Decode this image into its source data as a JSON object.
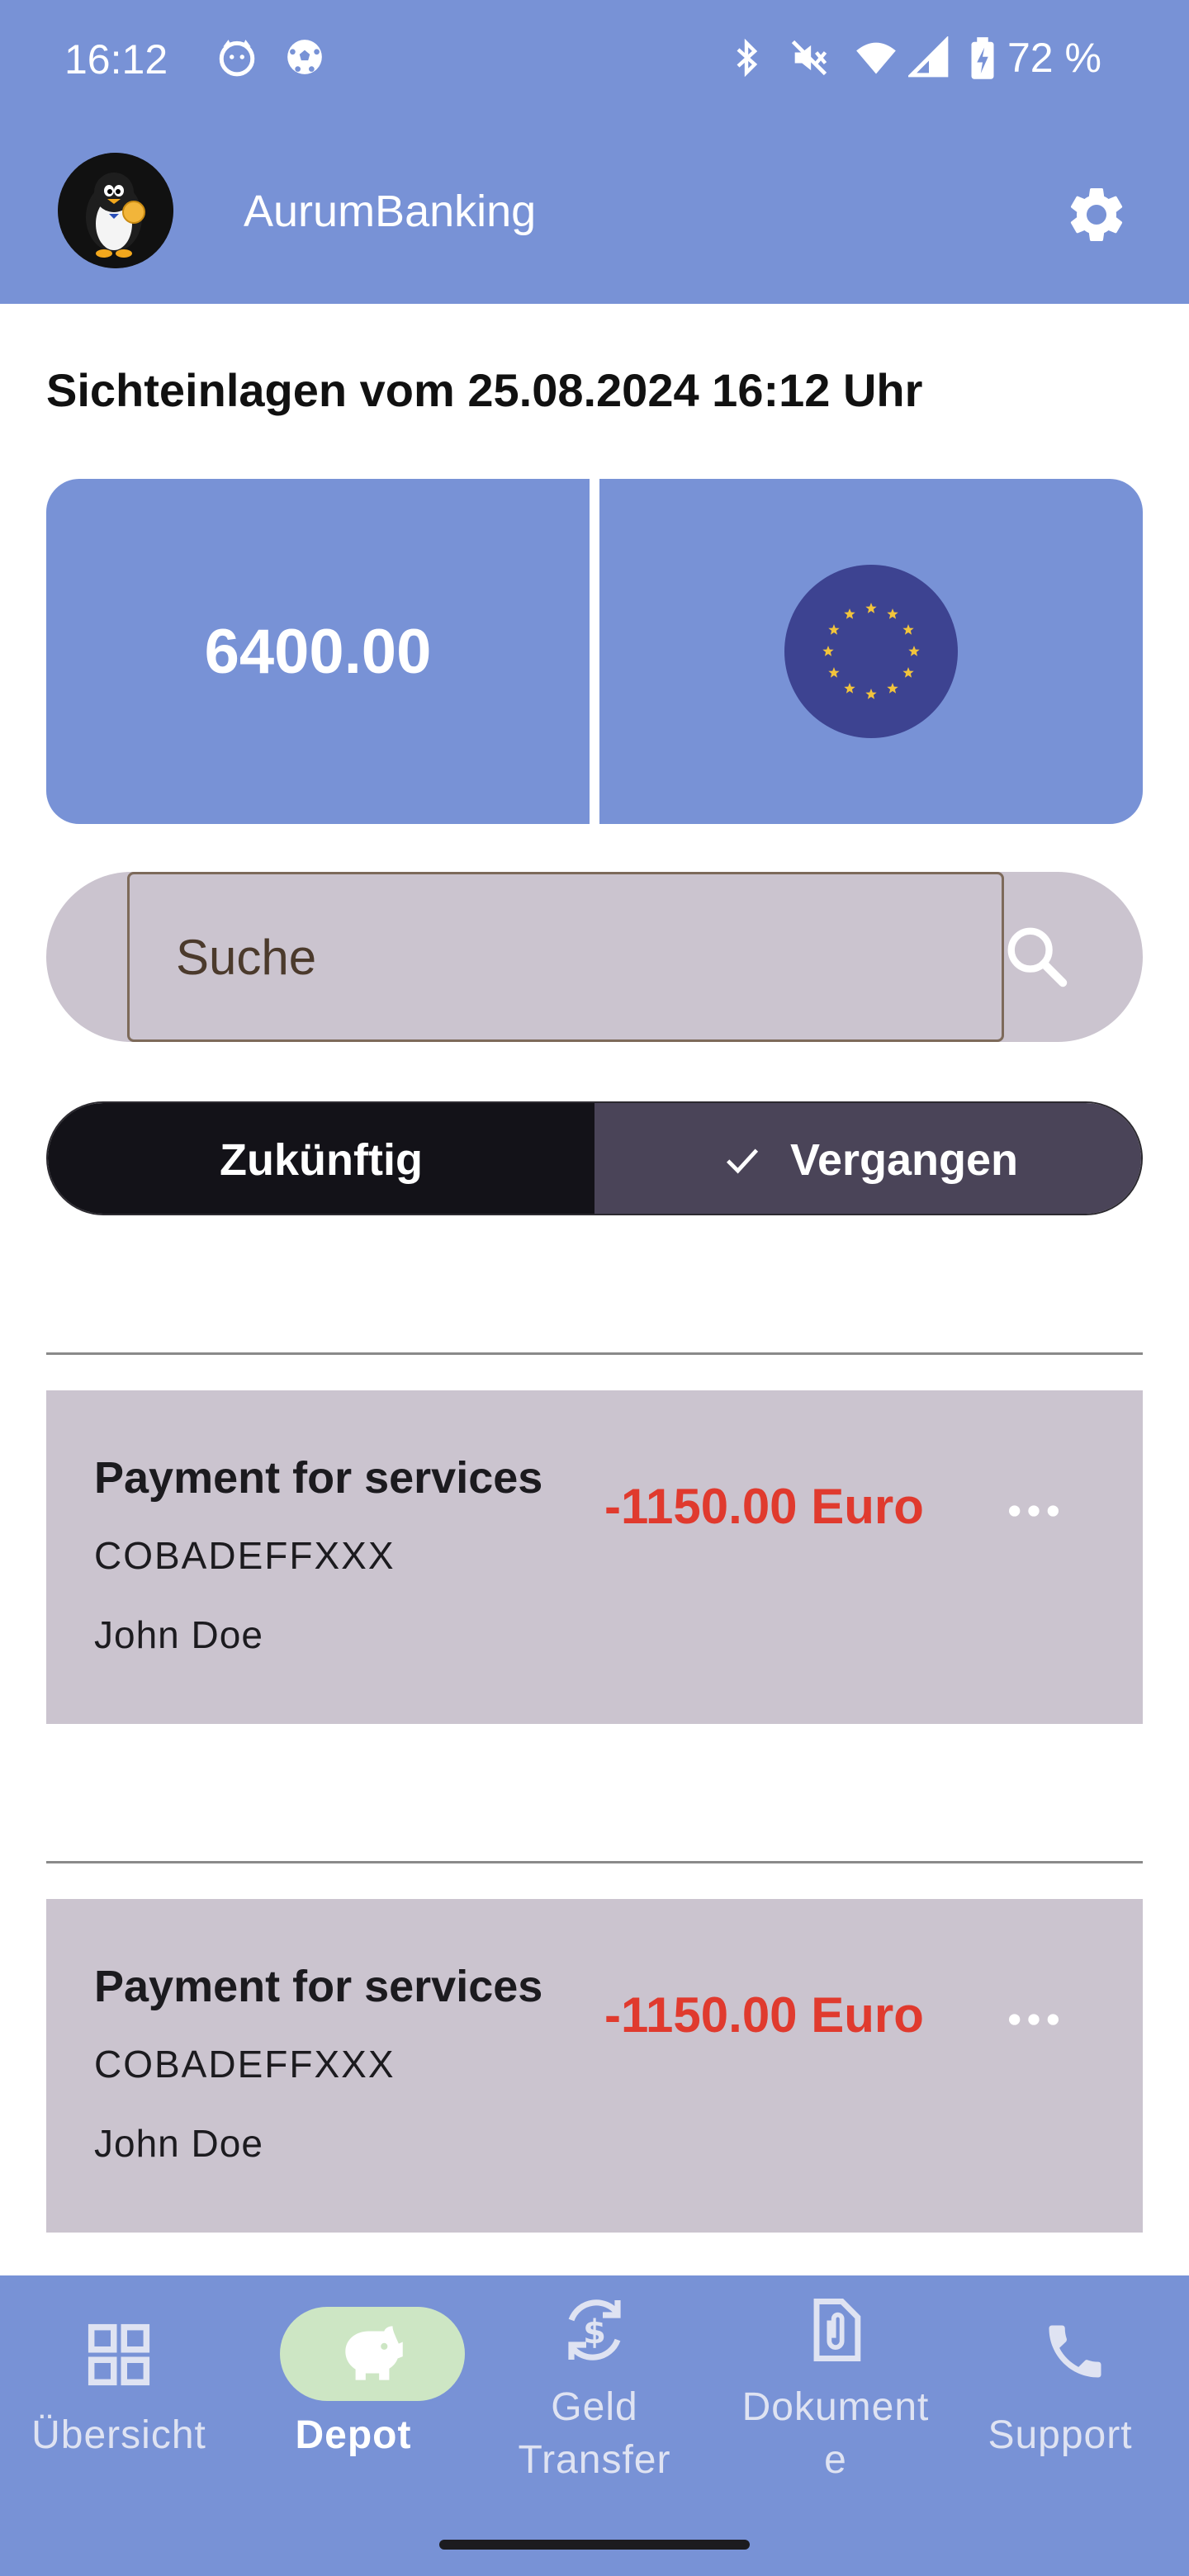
{
  "status_bar": {
    "time": "16:12",
    "battery": "72 %",
    "left_icons": [
      "cat-face-icon",
      "soccer-ball-icon"
    ],
    "right_icons": [
      "bluetooth-icon",
      "mute-icon",
      "wifi-icon",
      "cell-signal-icon",
      "battery-charging-icon"
    ]
  },
  "app_bar": {
    "title": "AurumBanking",
    "avatar_icon": "penguin-avatar-icon",
    "settings_icon": "gear-icon"
  },
  "heading": "Sichteinlagen vom 25.08.2024 16:12 Uhr",
  "balance": {
    "value": "6400.00",
    "currency_icon": "eu-flag-icon"
  },
  "search": {
    "placeholder": "Suche",
    "value": ""
  },
  "toggle": {
    "future_label": "Zukünftig",
    "past_label": "Vergangen",
    "selected": "past"
  },
  "transactions": [
    {
      "title": "Payment for services",
      "bic": "COBADEFFXXX",
      "name": "John Doe",
      "amount": "-1150.00 Euro"
    },
    {
      "title": "Payment for services",
      "bic": "COBADEFFXXX",
      "name": "John Doe",
      "amount": "-1150.00 Euro"
    }
  ],
  "bottom_nav": {
    "items": [
      {
        "label": "Übersicht",
        "icon": "grid-icon"
      },
      {
        "label": "Depot",
        "icon": "piggy-bank-icon",
        "active": true
      },
      {
        "label": "Geld Transfer",
        "label_line1": "Geld",
        "label_line2": "Transfer",
        "icon": "currency-exchange-icon"
      },
      {
        "label": "Dokumente",
        "label_line1": "Dokument",
        "label_line2": "e",
        "icon": "attachment-document-icon"
      },
      {
        "label": "Support",
        "icon": "phone-icon"
      }
    ]
  },
  "colors": {
    "primary": "#7892d6",
    "surface": "#cbc4cf",
    "negative_amount": "#e03a2e",
    "active_pill": "#cde6c4",
    "toggle_dark": "#131218",
    "toggle_selected": "#4a4458",
    "eu_blue": "#3d4391",
    "eu_star": "#f2c43c"
  }
}
